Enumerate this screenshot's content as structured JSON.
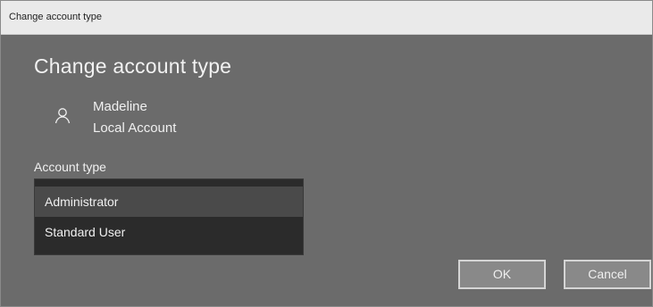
{
  "window": {
    "title": "Change account type"
  },
  "main": {
    "heading": "Change account type",
    "user": {
      "icon": "user-icon",
      "name": "Madeline",
      "account_kind": "Local Account"
    },
    "account_type": {
      "label": "Account type",
      "options": [
        {
          "label": "Administrator",
          "state": "hovered"
        },
        {
          "label": "Standard User",
          "state": "normal"
        }
      ]
    }
  },
  "buttons": {
    "ok_label": "OK",
    "cancel_label": "Cancel"
  },
  "colors": {
    "dialog_background": "#6b6b6b",
    "titlebar_background": "#eaeaea",
    "list_background": "#2b2b2b",
    "hover_background": "#4a4a4a",
    "button_background": "#898989",
    "button_border": "#d5d5d5"
  }
}
